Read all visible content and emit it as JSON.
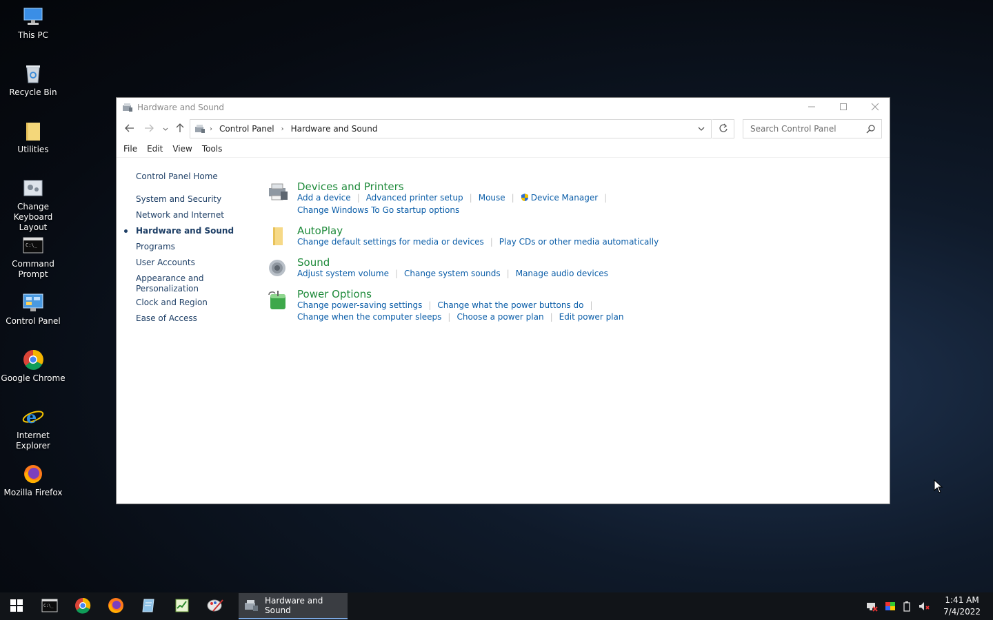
{
  "desktop": {
    "icons": [
      {
        "label": "This PC"
      },
      {
        "label": "Recycle Bin"
      },
      {
        "label": "Utilities"
      },
      {
        "label": "Change Keyboard Layout"
      },
      {
        "label": "Command Prompt"
      },
      {
        "label": "Control Panel"
      },
      {
        "label": "Google Chrome"
      },
      {
        "label": "Internet Explorer"
      },
      {
        "label": "Mozilla Firefox"
      }
    ]
  },
  "window": {
    "title": "Hardware and Sound",
    "breadcrumb": [
      "Control Panel",
      "Hardware and Sound"
    ],
    "search_placeholder": "Search Control Panel",
    "menu": [
      "File",
      "Edit",
      "View",
      "Tools"
    ],
    "leftnav": {
      "home": "Control Panel Home",
      "items": [
        "System and Security",
        "Network and Internet",
        "Hardware and Sound",
        "Programs",
        "User Accounts",
        "Appearance and Personalization",
        "Clock and Region",
        "Ease of Access"
      ],
      "selected": "Hardware and Sound"
    },
    "categories": [
      {
        "title": "Devices and Printers",
        "links": [
          "Add a device",
          "Advanced printer setup",
          "Mouse",
          "Device Manager",
          "Change Windows To Go startup options"
        ]
      },
      {
        "title": "AutoPlay",
        "links": [
          "Change default settings for media or devices",
          "Play CDs or other media automatically"
        ]
      },
      {
        "title": "Sound",
        "links": [
          "Adjust system volume",
          "Change system sounds",
          "Manage audio devices"
        ]
      },
      {
        "title": "Power Options",
        "links": [
          "Change power-saving settings",
          "Change what the power buttons do",
          "Change when the computer sleeps",
          "Choose a power plan",
          "Edit power plan"
        ]
      }
    ]
  },
  "taskbar": {
    "active_window": "Hardware and Sound",
    "time": "1:41 AM",
    "date": "7/4/2022"
  },
  "colors": {
    "link": "#0a5da8",
    "category_title": "#1e8a3a",
    "nav_text": "#1e3f66"
  }
}
